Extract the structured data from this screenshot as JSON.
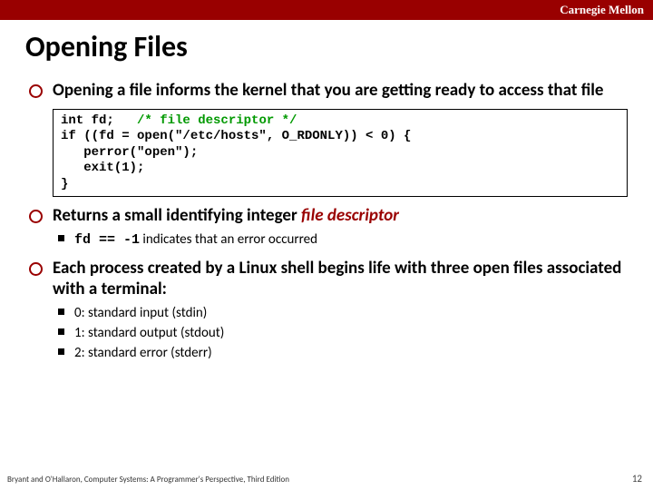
{
  "header": {
    "org": "Carnegie Mellon"
  },
  "title": "Opening Files",
  "bullets": [
    {
      "lead": "Opening a file informs the kernel that you are getting ready to access that file",
      "code": {
        "line1_pre": "int fd;   ",
        "line1_comment": "/* file descriptor */",
        "rest": "\nif ((fd = open(\"/etc/hosts\", O_RDONLY)) < 0) {\n   perror(\"open\");\n   exit(1);\n}"
      }
    },
    {
      "lead_pre": "Returns a small identifying integer ",
      "lead_em": "file descriptor",
      "sub": [
        {
          "mono": "fd == -1",
          "after": " indicates that an error occurred"
        }
      ]
    },
    {
      "lead": "Each process created by a Linux shell begins life with three open files associated with a terminal:",
      "sub": [
        {
          "text": "0: standard input (stdin)"
        },
        {
          "text": "1: standard output (stdout)"
        },
        {
          "text": "2: standard error (stderr)"
        }
      ]
    }
  ],
  "footer": {
    "cite": "Bryant and O'Hallaron, Computer Systems: A Programmer's Perspective, Third Edition",
    "page": "12"
  }
}
